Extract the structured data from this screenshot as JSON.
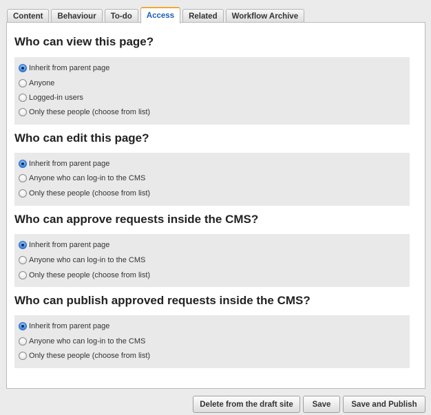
{
  "tabs": [
    {
      "label": "Content"
    },
    {
      "label": "Behaviour"
    },
    {
      "label": "To-do"
    },
    {
      "label": "Access",
      "active": true
    },
    {
      "label": "Related"
    },
    {
      "label": "Workflow Archive"
    }
  ],
  "sections": [
    {
      "title": "Who can view this page?",
      "options": [
        {
          "label": "Inherit from parent page",
          "checked": true
        },
        {
          "label": "Anyone",
          "checked": false
        },
        {
          "label": "Logged-in users",
          "checked": false
        },
        {
          "label": "Only these people (choose from list)",
          "checked": false
        }
      ]
    },
    {
      "title": "Who can edit this page?",
      "options": [
        {
          "label": "Inherit from parent page",
          "checked": true
        },
        {
          "label": "Anyone who can log-in to the CMS",
          "checked": false
        },
        {
          "label": "Only these people (choose from list)",
          "checked": false
        }
      ]
    },
    {
      "title": "Who can approve requests inside the CMS?",
      "options": [
        {
          "label": "Inherit from parent page",
          "checked": true
        },
        {
          "label": "Anyone who can log-in to the CMS",
          "checked": false
        },
        {
          "label": "Only these people (choose from list)",
          "checked": false
        }
      ]
    },
    {
      "title": "Who can publish approved requests inside the CMS?",
      "options": [
        {
          "label": "Inherit from parent page",
          "checked": true
        },
        {
          "label": "Anyone who can log-in to the CMS",
          "checked": false
        },
        {
          "label": "Only these people (choose from list)",
          "checked": false
        }
      ]
    }
  ],
  "actions": {
    "delete_label": "Delete from the draft site",
    "save_label": "Save",
    "publish_label": "Save and Publish"
  }
}
